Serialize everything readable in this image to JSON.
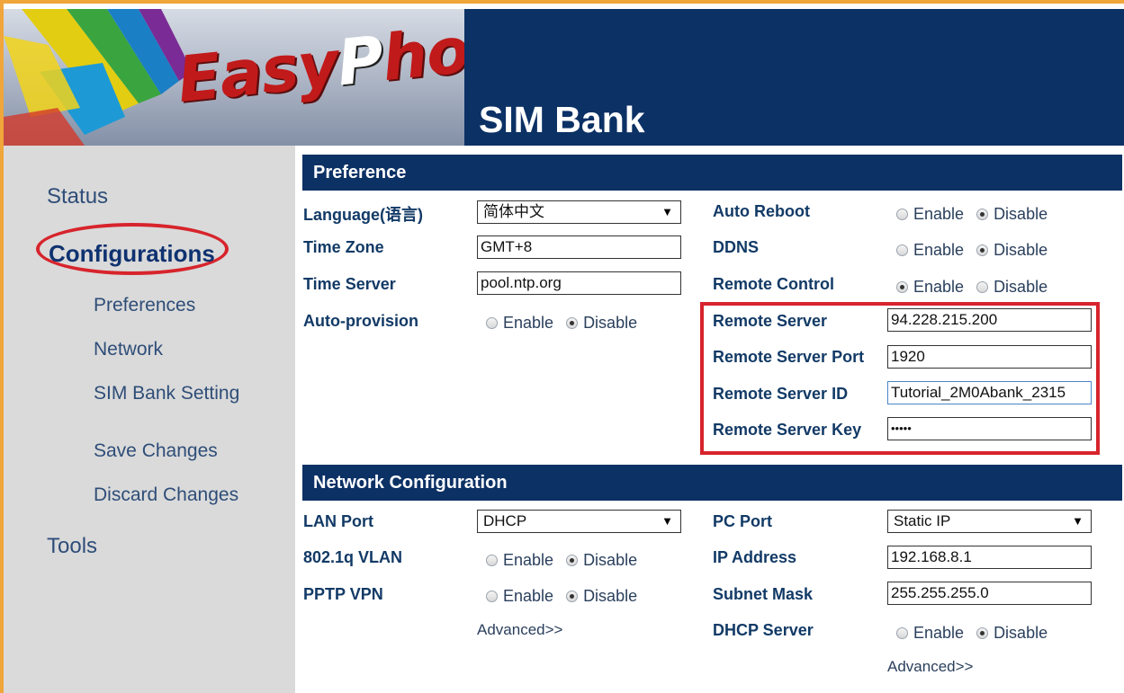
{
  "header": {
    "logo_text_pre": "Easy",
    "logo_text_p": "P",
    "logo_text_post": "hone",
    "product_title": "SIM Bank"
  },
  "sidebar": {
    "status": "Status",
    "configurations": "Configurations",
    "preferences": "Preferences",
    "network": "Network",
    "sim_bank_setting": "SIM Bank Setting",
    "save_changes": "Save Changes",
    "discard_changes": "Discard Changes",
    "tools": "Tools"
  },
  "preference": {
    "title": "Preference",
    "language_label": "Language(语言)",
    "language_value": "简体中文",
    "timezone_label": "Time Zone",
    "timezone_value": "GMT+8",
    "timeserver_label": "Time Server",
    "timeserver_value": "pool.ntp.org",
    "autoprov_label": "Auto-provision",
    "autoreboot_label": "Auto Reboot",
    "ddns_label": "DDNS",
    "remotecontrol_label": "Remote Control",
    "remoteserver_label": "Remote Server",
    "remoteserver_value": "94.228.215.200",
    "remoteport_label": "Remote Server Port",
    "remoteport_value": "1920",
    "remoteid_label": "Remote Server ID",
    "remoteid_value": "Tutorial_2M0Abank_2315",
    "remotekey_label": "Remote Server Key",
    "remotekey_value": "•••••",
    "enable": "Enable",
    "disable": "Disable"
  },
  "network": {
    "title": "Network Configuration",
    "lanport_label": "LAN Port",
    "lanport_value": "DHCP",
    "vlan_label": "802.1q VLAN",
    "pptp_label": "PPTP VPN",
    "advanced_left": "Advanced>>",
    "pcport_label": "PC Port",
    "pcport_value": "Static IP",
    "ip_label": "IP Address",
    "ip_value": "192.168.8.1",
    "subnet_label": "Subnet Mask",
    "subnet_value": "255.255.255.0",
    "dhcp_label": "DHCP Server",
    "advanced_right": "Advanced>>",
    "enable": "Enable",
    "disable": "Disable"
  },
  "colors": {
    "header_bg": "#0c3165",
    "sidebar_bg": "#dadada",
    "highlight": "#d7242c",
    "frame": "#f0a63a"
  }
}
